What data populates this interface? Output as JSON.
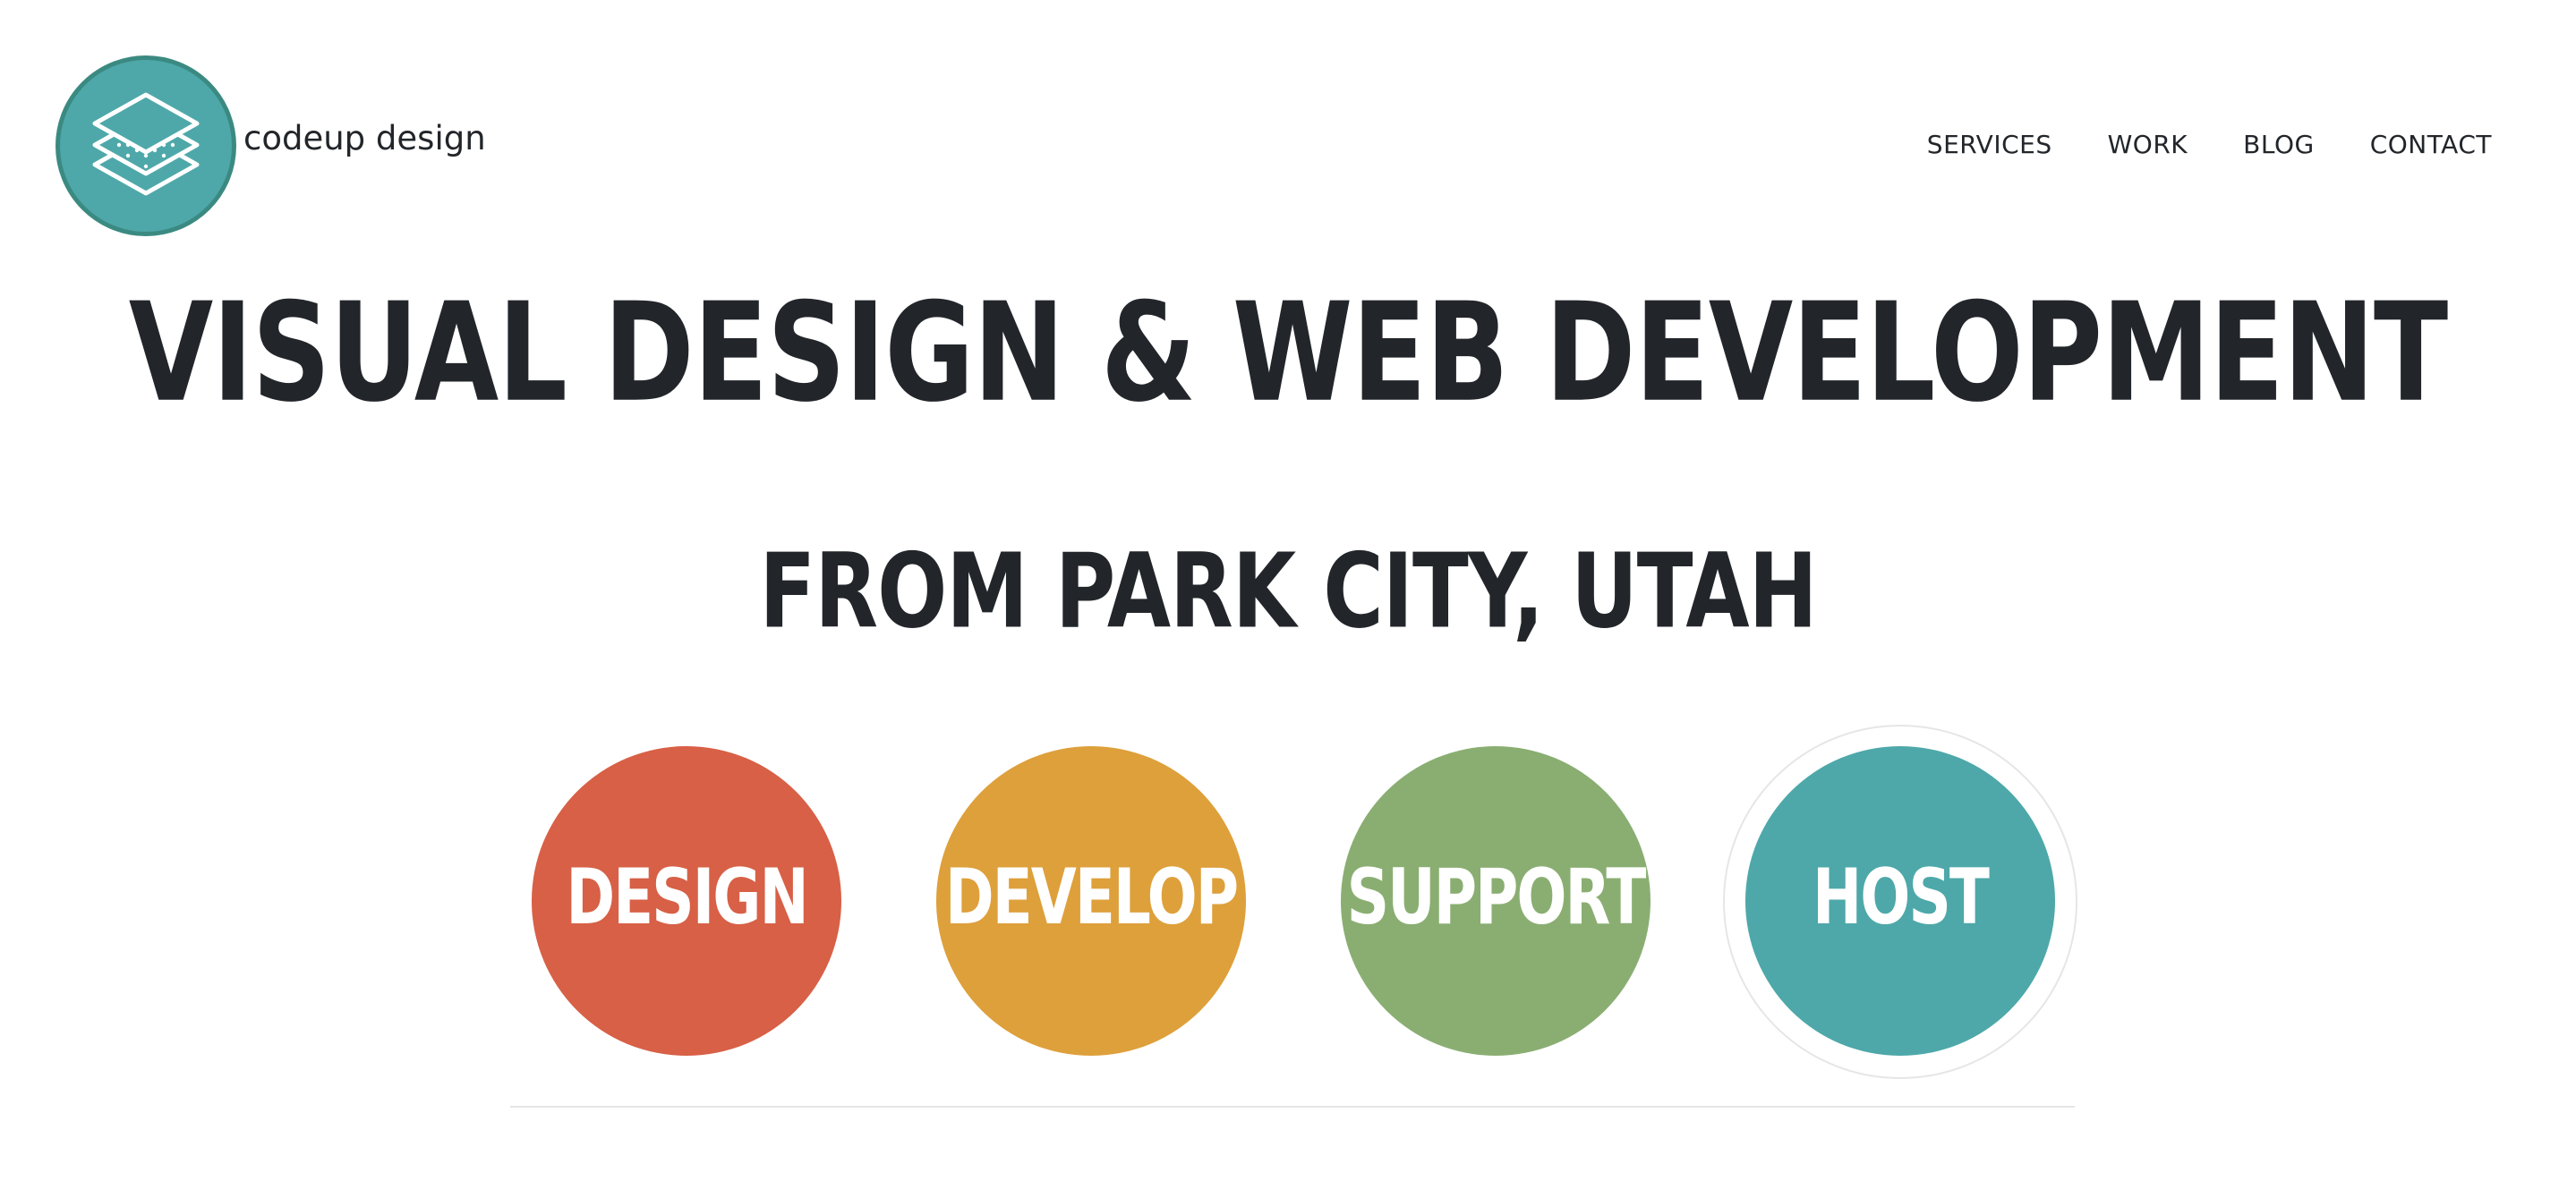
{
  "header": {
    "brand_name": "codeup design",
    "logo_icon": "layers-icon",
    "nav": [
      {
        "label": "SERVICES"
      },
      {
        "label": "WORK"
      },
      {
        "label": "BLOG"
      },
      {
        "label": "CONTACT"
      }
    ]
  },
  "hero": {
    "headline": "VISUAL DESIGN & WEB DEVELOPMENT",
    "subheadline": "FROM PARK CITY, UTAH"
  },
  "services": [
    {
      "label": "DESIGN",
      "color": "#d76046"
    },
    {
      "label": "DEVELOP",
      "color": "#dea03b"
    },
    {
      "label": "SUPPORT",
      "color": "#8aae72"
    },
    {
      "label": "HOST",
      "color": "#4ea8a9"
    }
  ],
  "colors": {
    "text": "#22262a",
    "logo_bg": "#4ea8a9",
    "logo_border": "#3b8a82",
    "divider": "#e5e5e5"
  }
}
